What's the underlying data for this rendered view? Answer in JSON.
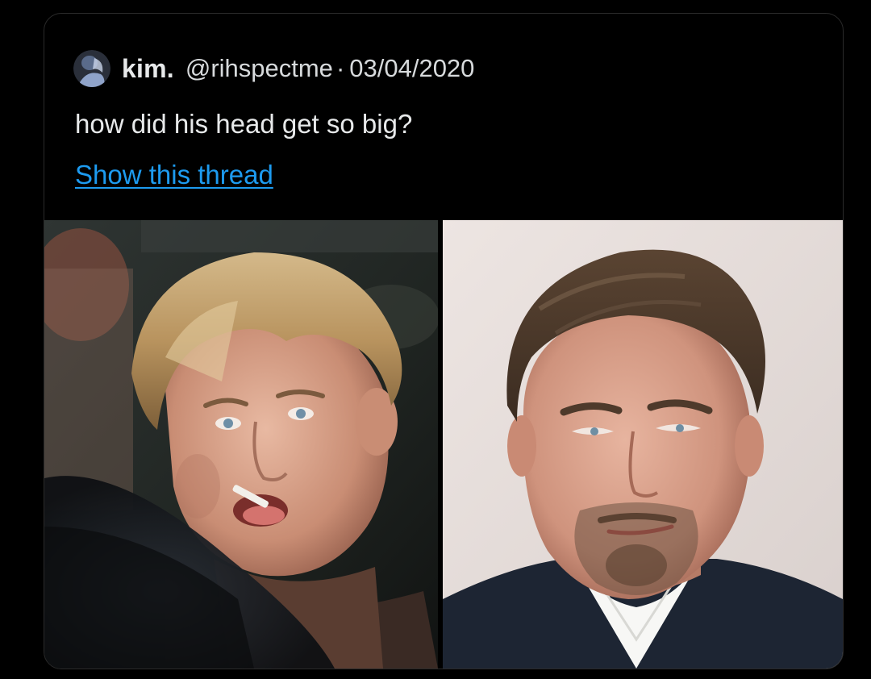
{
  "tweet": {
    "display_name": "kim.",
    "handle": "@rihspectme",
    "separator": "·",
    "date": "03/04/2020",
    "text": "how did his head get so big?",
    "show_thread_label": "Show this thread"
  },
  "media": {
    "images": [
      {
        "icon": "photo-young-man-with-toothpick"
      },
      {
        "icon": "photo-older-man-in-suit"
      }
    ]
  },
  "colors": {
    "background": "#000000",
    "text": "#e7e9ea",
    "link": "#1d9bf0",
    "border": "#2b2b2b"
  }
}
